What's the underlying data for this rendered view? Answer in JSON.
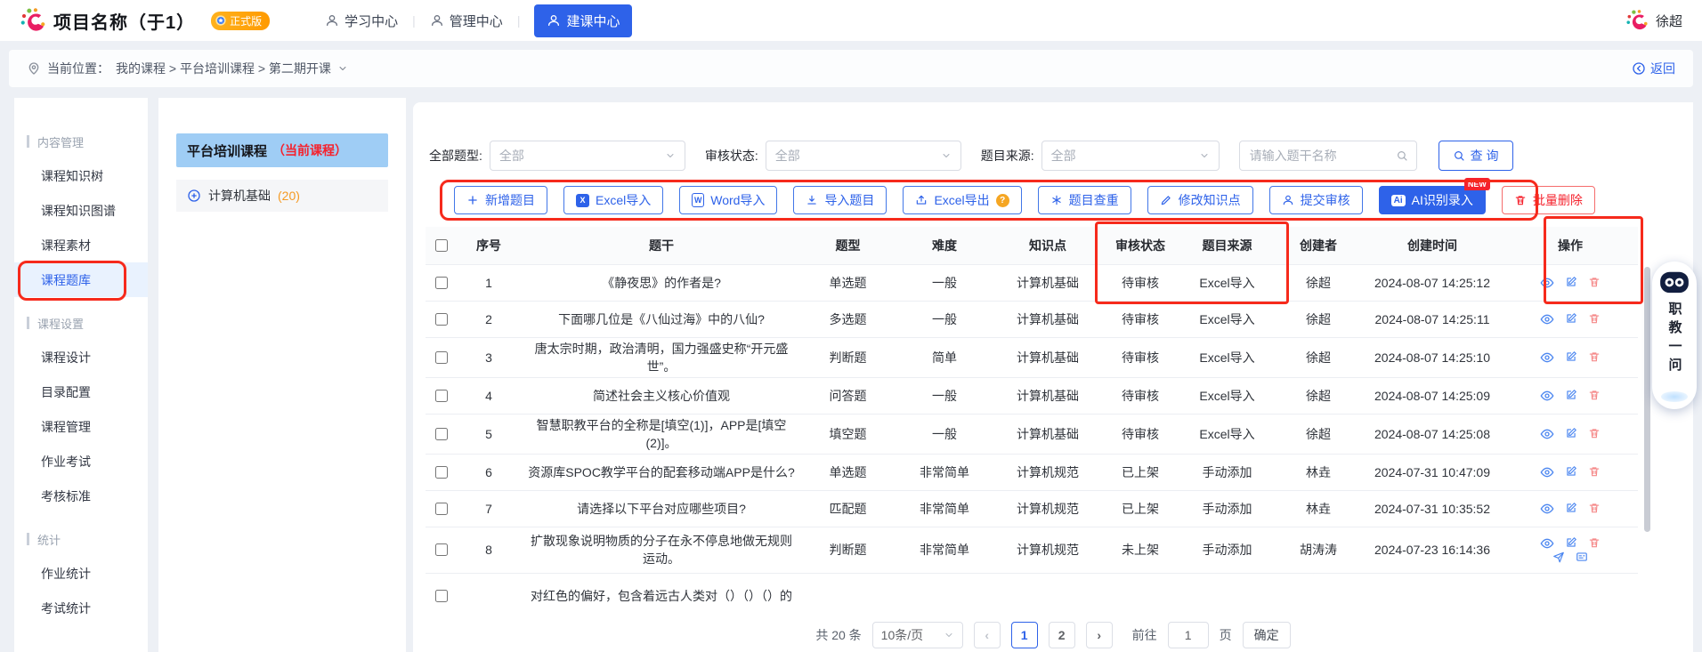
{
  "header": {
    "title": "项目名称（于1）",
    "badge": "正式版",
    "nav": [
      {
        "label": "学习中心"
      },
      {
        "label": "管理中心"
      },
      {
        "label": "建课中心"
      }
    ],
    "user": "徐超"
  },
  "breadcrumb": {
    "label": "当前位置：",
    "path": "我的课程 > 平台培训课程 > 第二期开课",
    "back": "返回"
  },
  "sidebar": {
    "sections": [
      {
        "title": "内容管理",
        "items": [
          "课程知识树",
          "课程知识图谱",
          "课程素材",
          "课程题库"
        ]
      },
      {
        "title": "课程设置",
        "items": [
          "课程设计",
          "目录配置",
          "课程管理",
          "作业考试",
          "考核标准"
        ]
      },
      {
        "title": "统计",
        "items": [
          "作业统计",
          "考试统计"
        ]
      }
    ]
  },
  "course_tree": {
    "current_course": "平台培训课程",
    "current_tag": "（当前课程）",
    "node": "计算机基础",
    "node_count": "(20)"
  },
  "filters": {
    "type_label": "全部题型:",
    "type_value": "全部",
    "status_label": "审核状态:",
    "status_value": "全部",
    "source_label": "题目来源:",
    "source_value": "全部",
    "search_placeholder": "请输入题干名称",
    "query_button": "查 询"
  },
  "icons": {
    "excel_letter": "X",
    "word_letter": "W",
    "ai_letter": "Ai",
    "help": "?"
  },
  "toolbar": {
    "buttons": [
      {
        "label": "新增题目"
      },
      {
        "label": "Excel导入"
      },
      {
        "label": "Word导入"
      },
      {
        "label": "导入题目"
      },
      {
        "label": "Excel导出"
      },
      {
        "label": "题目查重"
      },
      {
        "label": "修改知识点"
      },
      {
        "label": "提交审核"
      },
      {
        "label": "AI识别录入",
        "badge": "NEW"
      },
      {
        "label": "批量删除"
      }
    ]
  },
  "table": {
    "headers": [
      "序号",
      "题干",
      "题型",
      "难度",
      "知识点",
      "审核状态",
      "题目来源",
      "创建者",
      "创建时间",
      "操作"
    ],
    "rows": [
      {
        "seq": "1",
        "stem": "《静夜思》的作者是?",
        "type": "单选题",
        "difficulty": "一般",
        "knowledge": "计算机基础",
        "status": "待审核",
        "source": "Excel导入",
        "creator": "徐超",
        "time": "2024-08-07 14:25:12"
      },
      {
        "seq": "2",
        "stem": "下面哪几位是《八仙过海》中的八仙?",
        "type": "多选题",
        "difficulty": "一般",
        "knowledge": "计算机基础",
        "status": "待审核",
        "source": "Excel导入",
        "creator": "徐超",
        "time": "2024-08-07 14:25:11"
      },
      {
        "seq": "3",
        "stem": "唐太宗时期，政治清明，国力强盛史称“开元盛世”。",
        "type": "判断题",
        "difficulty": "简单",
        "knowledge": "计算机基础",
        "status": "待审核",
        "source": "Excel导入",
        "creator": "徐超",
        "time": "2024-08-07 14:25:10"
      },
      {
        "seq": "4",
        "stem": "简述社会主义核心价值观",
        "type": "问答题",
        "difficulty": "一般",
        "knowledge": "计算机基础",
        "status": "待审核",
        "source": "Excel导入",
        "creator": "徐超",
        "time": "2024-08-07 14:25:09"
      },
      {
        "seq": "5",
        "stem": "智慧职教平台的全称是[填空(1)]，APP是[填空(2)]。",
        "type": "填空题",
        "difficulty": "一般",
        "knowledge": "计算机基础",
        "status": "待审核",
        "source": "Excel导入",
        "creator": "徐超",
        "time": "2024-08-07 14:25:08"
      },
      {
        "seq": "6",
        "stem": "资源库SPOC教学平台的配套移动端APP是什么?",
        "type": "单选题",
        "difficulty": "非常简单",
        "knowledge": "计算机规范",
        "status": "已上架",
        "source": "手动添加",
        "creator": "林垚",
        "time": "2024-07-31 10:47:09"
      },
      {
        "seq": "7",
        "stem": "请选择以下平台对应哪些项目?",
        "type": "匹配题",
        "difficulty": "非常简单",
        "knowledge": "计算机规范",
        "status": "已上架",
        "source": "手动添加",
        "creator": "林垚",
        "time": "2024-07-31 10:35:52"
      },
      {
        "seq": "8",
        "stem": "扩散现象说明物质的分子在永不停息地做无规则运动。",
        "type": "判断题",
        "difficulty": "非常简单",
        "knowledge": "计算机规范",
        "status": "未上架",
        "source": "手动添加",
        "creator": "胡涛涛",
        "time": "2024-07-23 16:14:36"
      }
    ],
    "partial_row_stem": "对红色的偏好，包含着远古人类对（）（）（）的"
  },
  "pagination": {
    "total": "共 20 条",
    "page_size": "10条/页",
    "pages": [
      "1",
      "2"
    ],
    "goto_label": "前往",
    "goto_value": "1",
    "page_unit": "页",
    "confirm": "确定"
  },
  "assistant_widget": {
    "label": "职教一问"
  },
  "colors": {
    "primary_blue": "#2e62e9",
    "annotation_red": "#f62a1c",
    "badge_orange": "#ff9a00",
    "current_course_blue": "#9fcdf5",
    "count_orange": "#f59a23",
    "danger_red": "#f5222d"
  }
}
